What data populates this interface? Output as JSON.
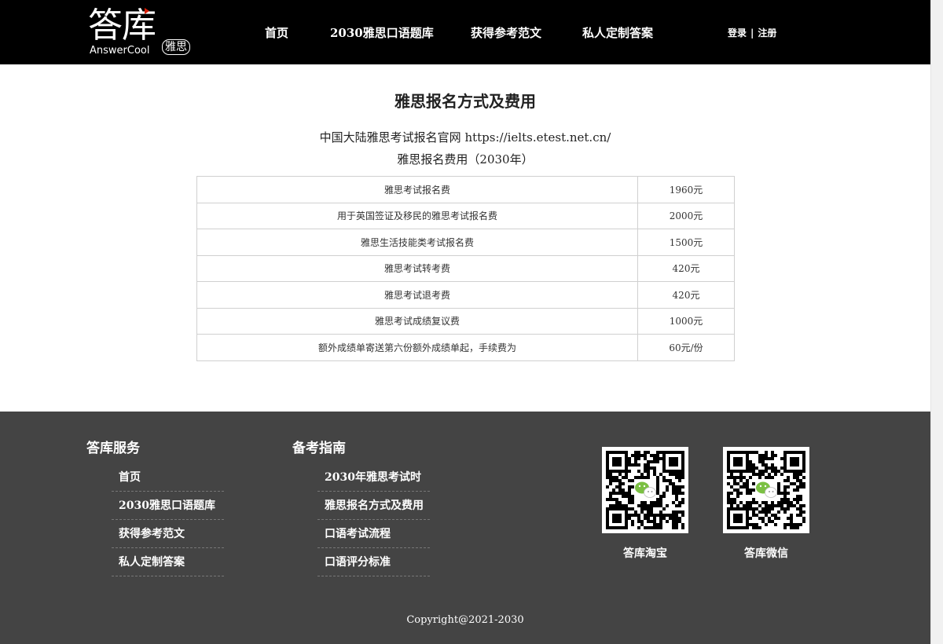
{
  "header": {
    "logo": {
      "main": "答库",
      "sub": "AnswerCool",
      "tag": "雅思"
    },
    "nav": [
      "首页",
      "2030雅思口语题库",
      "获得参考范文",
      "私人定制答案"
    ],
    "login": "登录",
    "separator": "|",
    "register": "注册"
  },
  "main": {
    "title": "雅思报名方式及费用",
    "site_line": "中国大陆雅思考试报名官网 https://ielts.etest.net.cn/",
    "fee_line": "雅思报名费用（2030年）",
    "fees": [
      {
        "item": "雅思考试报名费",
        "price": "1960元"
      },
      {
        "item": "用于英国签证及移民的雅思考试报名费",
        "price": "2000元"
      },
      {
        "item": "雅思生活技能类考试报名费",
        "price": "1500元"
      },
      {
        "item": "雅思考试转考费",
        "price": "420元"
      },
      {
        "item": "雅思考试退考费",
        "price": "420元"
      },
      {
        "item": "雅思考试成绩复议费",
        "price": "1000元"
      },
      {
        "item": "额外成绩单寄送第六份额外成绩单起，手续费为",
        "price": "60元/份"
      }
    ]
  },
  "footer": {
    "services_title": "答库服务",
    "services": [
      "首页",
      "2030雅思口语题库",
      "获得参考范文",
      "私人定制答案"
    ],
    "guide_title": "备考指南",
    "guide": [
      "2030年雅思考试时",
      "雅思报名方式及费用",
      "口语考试流程",
      "口语评分标准"
    ],
    "qr_codes": [
      {
        "label": "答库淘宝",
        "icon": "wechat-qr-icon"
      },
      {
        "label": "答库微信",
        "icon": "wechat-qr-icon"
      }
    ],
    "copyright": "Copyright@2021-2030"
  },
  "colors": {
    "header_bg": "#000000",
    "footer_bg": "#444444",
    "logo_accent": "#d81e06",
    "wechat_green": "#7bc043"
  }
}
